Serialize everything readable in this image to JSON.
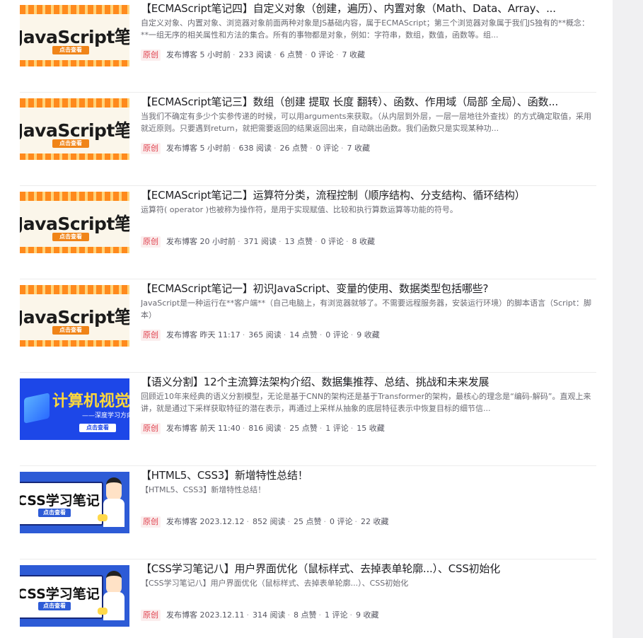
{
  "articles": [
    {
      "thumb": {
        "kind": "javascript",
        "text": "JavaScript笔记",
        "cta": "点击查看"
      },
      "title": "【ECMAScript笔记四】自定义对象（创建，遍历）、内置对象（Math、Data、Array、...",
      "desc": "自定义对象、内置对象、浏览器对象前面两种对象是JS基础内容，属于ECMAScript；第三个浏览器对象属于我们JS独有的**概念：**一组无序的相关属性和方法的集合。所有的事物都是对象，例如：字符串，数组，数值，函数等。组...",
      "badge": "原创",
      "source": "发布博客",
      "time": "5 小时前",
      "reads": "233 阅读",
      "likes": "6 点赞",
      "comments": "0 评论",
      "favorites": "7 收藏"
    },
    {
      "thumb": {
        "kind": "javascript",
        "text": "JavaScript笔记",
        "cta": "点击查看"
      },
      "title": "【ECMAScript笔记三】数组（创建 提取 长度 翻转）、函数、作用域（局部 全局）、函数...",
      "desc": "当我们不确定有多少个实参传递的时候，可以用arguments来获取。（从内层到外层，一层一层地往外查找）的方式确定取值，采用就近原则。只要遇到return，就把需要返回的结果返回出来，自动跳出函数。我们函数只是实现某种功...",
      "badge": "原创",
      "source": "发布博客",
      "time": "5 小时前",
      "reads": "638 阅读",
      "likes": "26 点赞",
      "comments": "0 评论",
      "favorites": "7 收藏"
    },
    {
      "thumb": {
        "kind": "javascript",
        "text": "JavaScript笔记",
        "cta": "点击查看"
      },
      "title": "【ECMAScript笔记二】运算符分类，流程控制（顺序结构、分支结构、循环结构）",
      "desc": "运算符( operator )也被称为操作符，是用于实现赋值、比较和执行算数运算等功能的符号。",
      "badge": "原创",
      "source": "发布博客",
      "time": "20 小时前",
      "reads": "371 阅读",
      "likes": "13 点赞",
      "comments": "0 评论",
      "favorites": "8 收藏"
    },
    {
      "thumb": {
        "kind": "javascript",
        "text": "JavaScript笔记",
        "cta": "点击查看"
      },
      "title": "【ECMAScript笔记一】初识JavaScript、变量的使用、数据类型包括哪些?",
      "desc": "JavaScript是一种运行在**客户端**（自己电脑上，有浏览器就够了。不需要远程服务器，安装运行环境）的脚本语言（Script：脚本）",
      "badge": "原创",
      "source": "发布博客",
      "time": "昨天 11:17",
      "reads": "365 阅读",
      "likes": "14 点赞",
      "comments": "0 评论",
      "favorites": "9 收藏"
    },
    {
      "thumb": {
        "kind": "vision",
        "text": "计算机视觉",
        "sub": "——深度学习方向",
        "cta": "点击查看"
      },
      "title": "【语义分割】12个主流算法架构介绍、数据集推荐、总结、挑战和未来发展",
      "desc": "回顾近10年来经典的语义分割模型，无论是基于CNN的架构还是基于Transformer的架构，最核心的理念是“编码-解码”。直观上来讲，就是通过下采样获取特征的潜在表示，再通过上采样从抽象的底层特征表示中恢复目标的细节信...",
      "badge": "原创",
      "source": "发布博客",
      "time": "前天 11:40",
      "reads": "816 阅读",
      "likes": "25 点赞",
      "comments": "1 评论",
      "favorites": "15 收藏"
    },
    {
      "thumb": {
        "kind": "css",
        "text": "CSS学习笔记",
        "cta": "点击查看"
      },
      "title": "【HTML5、CSS3】新增特性总结！",
      "desc": "【HTML5、CSS3】新增特性总结！",
      "badge": "原创",
      "source": "发布博客",
      "time": "2023.12.12",
      "reads": "852 阅读",
      "likes": "25 点赞",
      "comments": "0 评论",
      "favorites": "22 收藏"
    },
    {
      "thumb": {
        "kind": "css",
        "text": "CSS学习笔记",
        "cta": "点击查看"
      },
      "title": "【CSS学习笔记八】用户界面优化（鼠标样式、去掉表单轮廓...）、CSS初始化",
      "desc": "【CSS学习笔记八】用户界面优化（鼠标样式、去掉表单轮廓...）、CSS初始化",
      "badge": "原创",
      "source": "发布博客",
      "time": "2023.12.11",
      "reads": "314 阅读",
      "likes": "8 点赞",
      "comments": "1 评论",
      "favorites": "9 收藏"
    }
  ]
}
